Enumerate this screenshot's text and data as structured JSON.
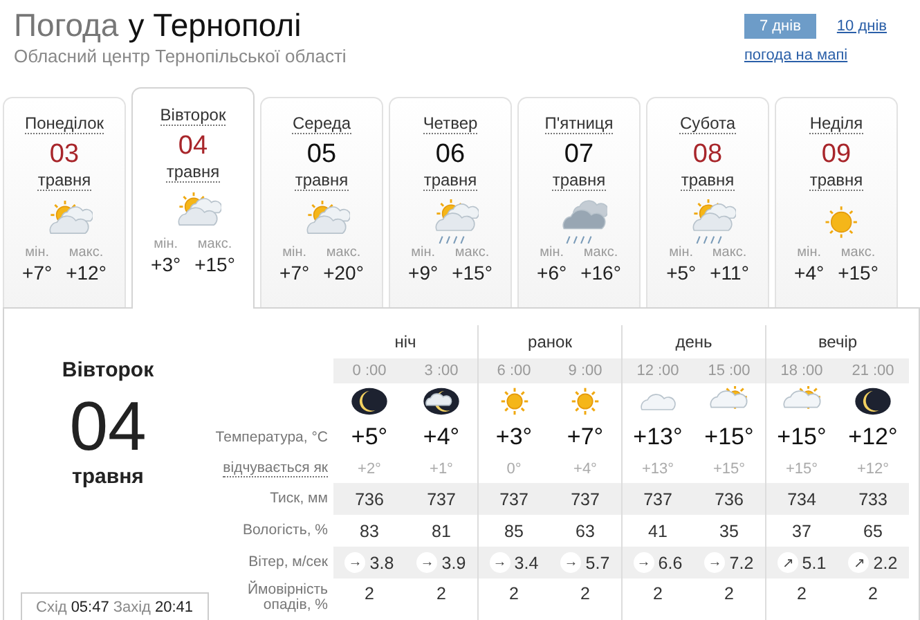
{
  "header": {
    "title_muted": "Погода",
    "title_city": "у Тернополі",
    "subtitle": "Обласний центр Тернопільської області"
  },
  "range_tabs": [
    {
      "label": "7 днів",
      "selected": true
    },
    {
      "label": "10 днів",
      "selected": false
    }
  ],
  "map_link": "погода на мапі",
  "days": [
    {
      "weekday": "Понеділок",
      "date": "03",
      "month": "травня",
      "holiday": true,
      "selected": false,
      "kind": "partly-cloudy",
      "min_label": "мін.",
      "min": "+7°",
      "max_label": "макс.",
      "max": "+12°"
    },
    {
      "weekday": "Вівторок",
      "date": "04",
      "month": "травня",
      "holiday": true,
      "selected": true,
      "kind": "partly-cloudy",
      "min_label": "мін.",
      "min": "+3°",
      "max_label": "макс.",
      "max": "+15°"
    },
    {
      "weekday": "Середа",
      "date": "05",
      "month": "травня",
      "holiday": false,
      "selected": false,
      "kind": "partly-cloudy",
      "min_label": "мін.",
      "min": "+7°",
      "max_label": "макс.",
      "max": "+20°"
    },
    {
      "weekday": "Четвер",
      "date": "06",
      "month": "травня",
      "holiday": false,
      "selected": false,
      "kind": "partly-cloudy-rain",
      "min_label": "мін.",
      "min": "+9°",
      "max_label": "макс.",
      "max": "+15°"
    },
    {
      "weekday": "П'ятниця",
      "date": "07",
      "month": "травня",
      "holiday": false,
      "selected": false,
      "kind": "storm",
      "min_label": "мін.",
      "min": "+6°",
      "max_label": "макс.",
      "max": "+16°"
    },
    {
      "weekday": "Субота",
      "date": "08",
      "month": "травня",
      "holiday": true,
      "selected": false,
      "kind": "partly-cloudy-rain",
      "min_label": "мін.",
      "min": "+5°",
      "max_label": "макс.",
      "max": "+11°"
    },
    {
      "weekday": "Неділя",
      "date": "09",
      "month": "травня",
      "holiday": true,
      "selected": false,
      "kind": "sun",
      "min_label": "мін.",
      "min": "+4°",
      "max_label": "макс.",
      "max": "+15°"
    }
  ],
  "detail": {
    "weekday": "Вівторок",
    "date": "04",
    "month": "травня",
    "sun": {
      "sunrise_label": "Схід",
      "sunrise": "05:47",
      "sunset_label": "Захід",
      "sunset": "20:41"
    },
    "periods": [
      "ніч",
      "ранок",
      "день",
      "вечір"
    ],
    "row_labels": {
      "temperature": "Температура, °С",
      "feels": "відчувається як",
      "pressure": "Тиск, мм",
      "humidity": "Вологість, %",
      "wind": "Вітер, м/сек",
      "precipitation": "Ймовірність опадів, %"
    },
    "hours": [
      {
        "time": "0 :00",
        "kind": "moon",
        "temperature": "+5°",
        "feels": "+2°",
        "pressure": "736",
        "humidity": "83",
        "wind_arrow": "→",
        "wind": "3.8",
        "precipitation": "2"
      },
      {
        "time": "3 :00",
        "kind": "moon-cloud",
        "temperature": "+4°",
        "feels": "+1°",
        "pressure": "737",
        "humidity": "81",
        "wind_arrow": "→",
        "wind": "3.9",
        "precipitation": "2"
      },
      {
        "time": "6 :00",
        "kind": "sun",
        "temperature": "+3°",
        "feels": "0°",
        "pressure": "737",
        "humidity": "85",
        "wind_arrow": "→",
        "wind": "3.4",
        "precipitation": "2"
      },
      {
        "time": "9 :00",
        "kind": "sun",
        "temperature": "+7°",
        "feels": "+4°",
        "pressure": "737",
        "humidity": "63",
        "wind_arrow": "→",
        "wind": "5.7",
        "precipitation": "2"
      },
      {
        "time": "12 :00",
        "kind": "cloud",
        "temperature": "+13°",
        "feels": "+13°",
        "pressure": "737",
        "humidity": "41",
        "wind_arrow": "→",
        "wind": "6.6",
        "precipitation": "2"
      },
      {
        "time": "15 :00",
        "kind": "cloud-sun",
        "temperature": "+15°",
        "feels": "+15°",
        "pressure": "736",
        "humidity": "35",
        "wind_arrow": "→",
        "wind": "7.2",
        "precipitation": "2"
      },
      {
        "time": "18 :00",
        "kind": "cloud-sun",
        "temperature": "+15°",
        "feels": "+15°",
        "pressure": "734",
        "humidity": "37",
        "wind_arrow": "↗",
        "wind": "5.1",
        "precipitation": "2"
      },
      {
        "time": "21 :00",
        "kind": "moon",
        "temperature": "+12°",
        "feels": "+12°",
        "pressure": "733",
        "humidity": "65",
        "wind_arrow": "↗",
        "wind": "2.2",
        "precipitation": "2"
      }
    ]
  }
}
